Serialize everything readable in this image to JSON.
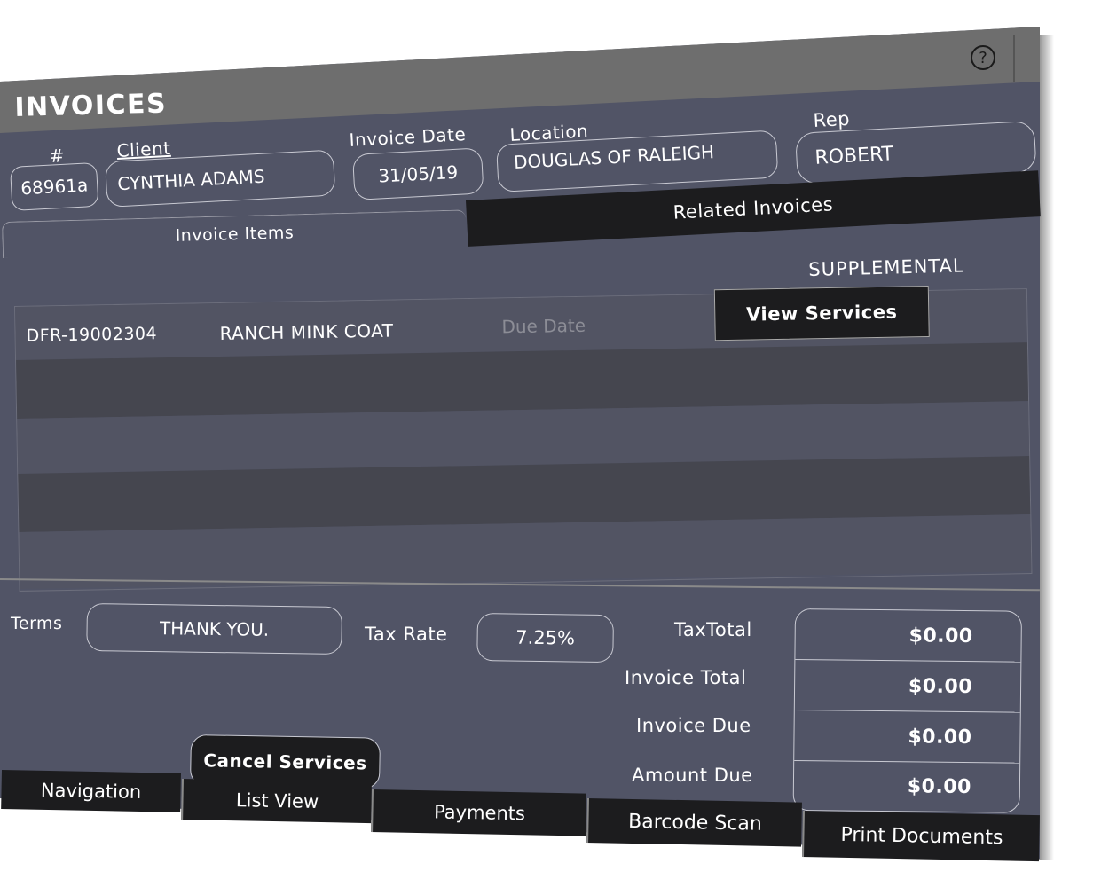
{
  "header": {
    "title": "INVOICES",
    "help_icon": "question-circle-icon"
  },
  "fields": {
    "number_label": "#",
    "number_value": "68961a",
    "client_label": "Client",
    "client_value": "CYNTHIA ADAMS",
    "invoice_date_label": "Invoice Date",
    "invoice_date_value": "31/05/19",
    "location_label": "Location",
    "location_value": "DOUGLAS OF RALEIGH",
    "rep_label": "Rep",
    "rep_value": "ROBERT"
  },
  "tabs": [
    {
      "label": "Invoice Items",
      "active": true
    },
    {
      "label": "Related Invoices",
      "active": false
    }
  ],
  "supplemental_label": "SUPPLEMENTAL",
  "items": [
    {
      "code": "DFR-19002304",
      "description": "RANCH MINK COAT",
      "due_date_placeholder": "Due Date",
      "action_label": "View Services"
    }
  ],
  "footer": {
    "terms_label": "Terms",
    "terms_value": "THANK YOU.",
    "tax_rate_label": "Tax Rate",
    "tax_rate_value": "7.25%",
    "tax_total_label": "TaxTotal",
    "tax_total_value": "$0.00",
    "invoice_total_label": "Invoice Total",
    "invoice_total_value": "$0.00",
    "invoice_due_label": "Invoice Due",
    "invoice_due_value": "$0.00",
    "amount_due_label": "Amount Due",
    "amount_due_value": "$0.00",
    "cancel_services_label": "Cancel Services"
  },
  "bottom_nav": [
    "Navigation",
    "List View",
    "Payments",
    "Barcode Scan",
    "Print Documents"
  ],
  "colors": {
    "panel": "#515466",
    "title_bar": "#6e6e6e",
    "dark": "#1c1c1e",
    "row_dark": "#45464f",
    "row_light": "#525463",
    "muted_text": "#8c8d96"
  }
}
